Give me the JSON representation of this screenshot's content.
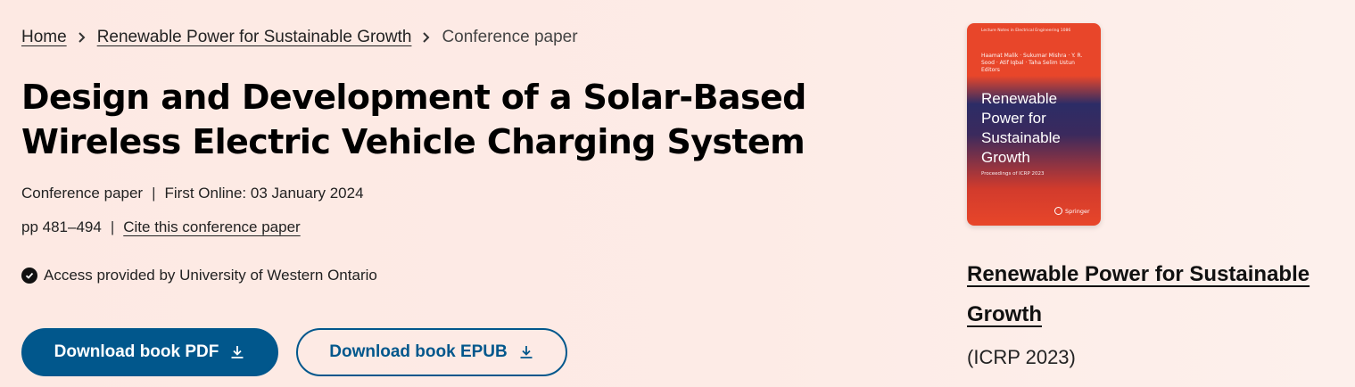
{
  "breadcrumb": {
    "home": "Home",
    "book": "Renewable Power for Sustainable Growth",
    "current": "Conference paper"
  },
  "title": "Design and Development of a Solar-Based Wireless Electric Vehicle Charging System",
  "meta": {
    "type": "Conference paper",
    "first_online": "First Online: 03 January 2024",
    "pages": "pp 481–494",
    "cite": "Cite this conference paper"
  },
  "access": "Access provided by University of Western Ontario",
  "buttons": {
    "pdf": "Download book PDF",
    "epub": "Download book EPUB"
  },
  "cover": {
    "series": "Lecture Notes in Electrical Engineering 1086",
    "editors": "Haamat Malik · Sukumar Mishra · Y. R. Sood · Atif Iqbal · Taha Selim Ustun  Editors",
    "title": "Renewable Power for Sustainable Growth",
    "subtitle": "Proceedings of ICRP 2023",
    "publisher": "Springer"
  },
  "book": {
    "title": "Renewable Power for Sustainable Growth",
    "conference": "(ICRP 2023)"
  },
  "colors": {
    "primary": "#01578c",
    "background": "#fde9e3",
    "cover_orange": "#e8462a",
    "cover_navy": "#2c2c66"
  },
  "icons": [
    "chevron-right-icon",
    "check-circle-icon",
    "download-icon",
    "springer-logo-icon"
  ]
}
